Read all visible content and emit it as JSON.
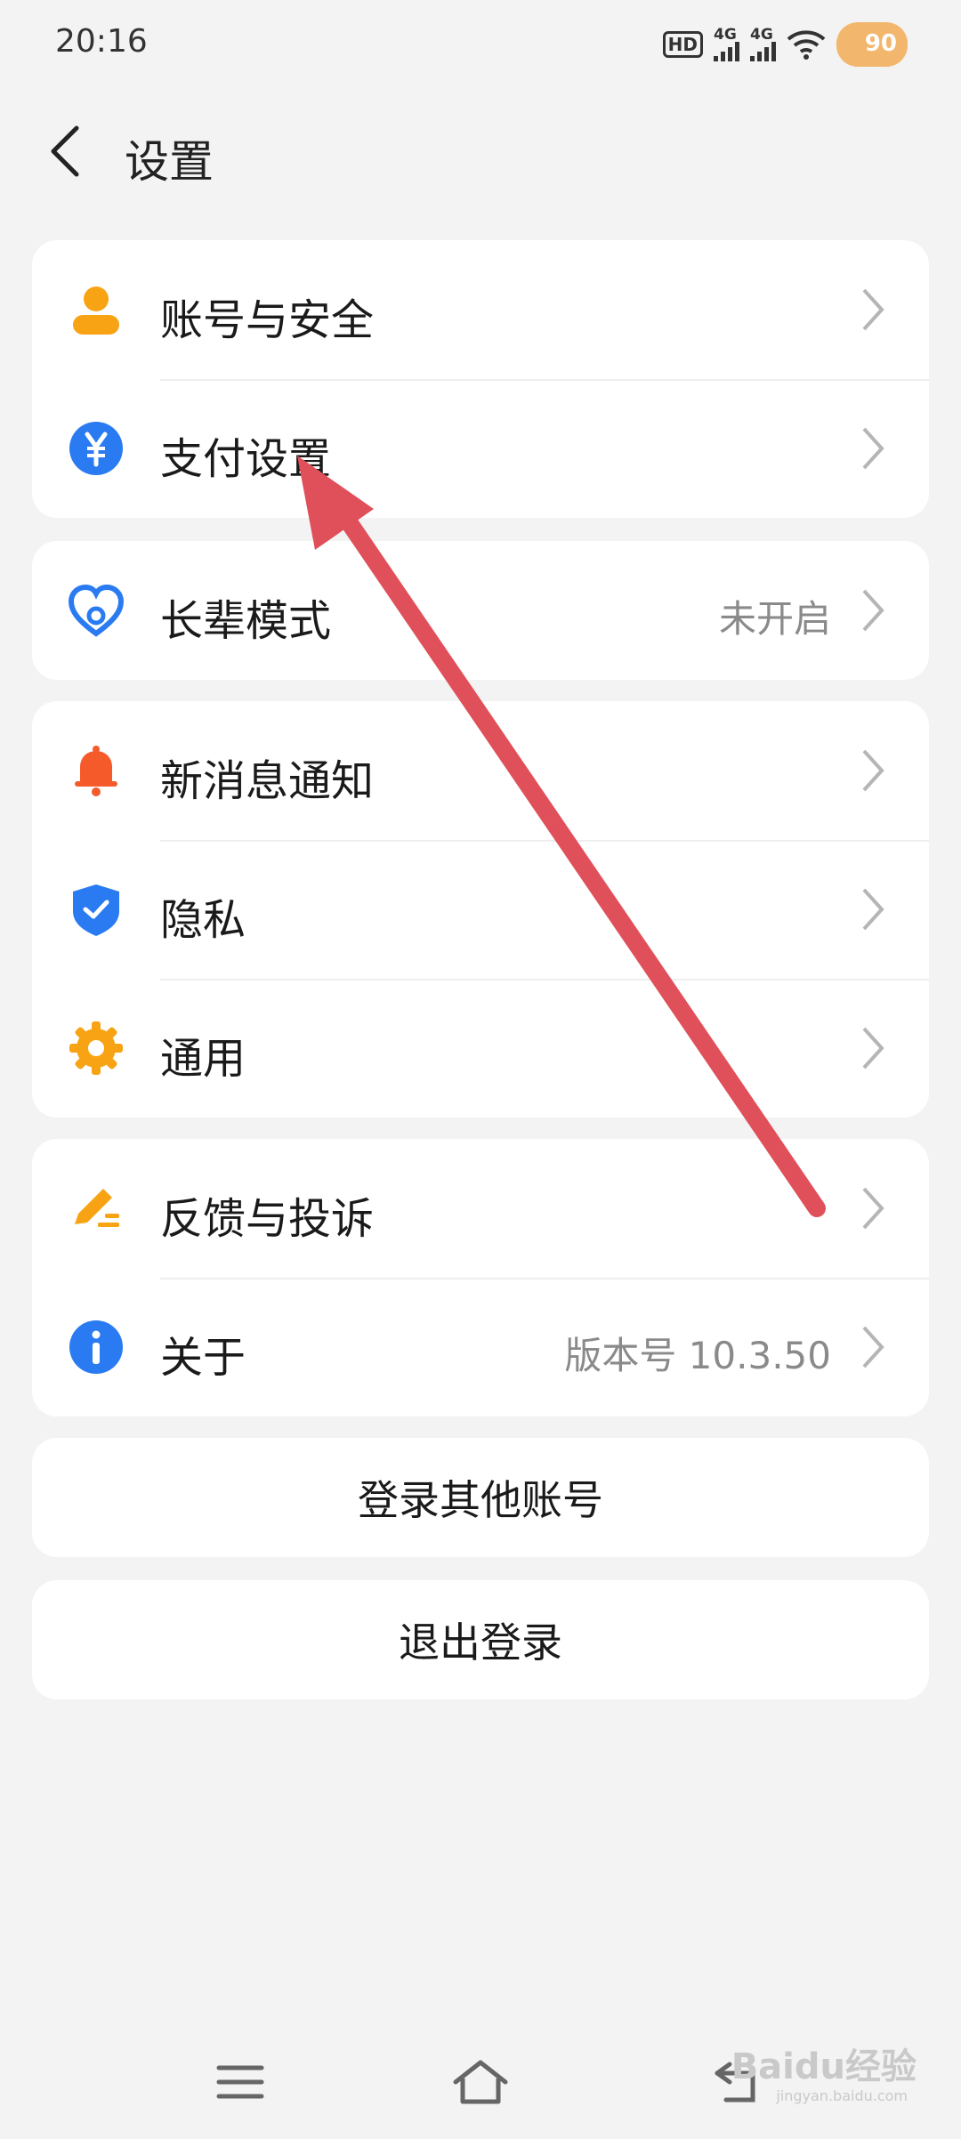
{
  "status_bar": {
    "time": "20:16",
    "hd_label": "HD",
    "sim1_label": "4G",
    "sim2_label": "4G",
    "battery": "90"
  },
  "header": {
    "title": "设置"
  },
  "groups": [
    {
      "items": [
        {
          "label": "账号与安全",
          "icon": "user-icon",
          "color": "#f7a313"
        },
        {
          "label": "支付设置",
          "icon": "yuan-icon",
          "color": "#2a7bf2"
        }
      ]
    },
    {
      "items": [
        {
          "label": "长辈模式",
          "value": "未开启",
          "icon": "heart-icon",
          "color": "#2a7bf2"
        }
      ]
    },
    {
      "items": [
        {
          "label": "新消息通知",
          "icon": "bell-icon",
          "color": "#f55a2b"
        },
        {
          "label": "隐私",
          "icon": "shield-icon",
          "color": "#2a7bf2"
        },
        {
          "label": "通用",
          "icon": "gear-icon",
          "color": "#f7a313"
        }
      ]
    },
    {
      "items": [
        {
          "label": "反馈与投诉",
          "icon": "pencil-icon",
          "color": "#f7a313"
        },
        {
          "label": "关于",
          "value": "版本号 10.3.50",
          "icon": "info-icon",
          "color": "#2a7bf2"
        }
      ]
    }
  ],
  "buttons": {
    "login_other": "登录其他账号",
    "logout": "退出登录"
  },
  "watermark": {
    "brand": "Baidu经验",
    "url": "jingyan.baidu.com"
  },
  "colors": {
    "annotation_arrow": "#e0505a",
    "background": "#f3f3f3"
  }
}
